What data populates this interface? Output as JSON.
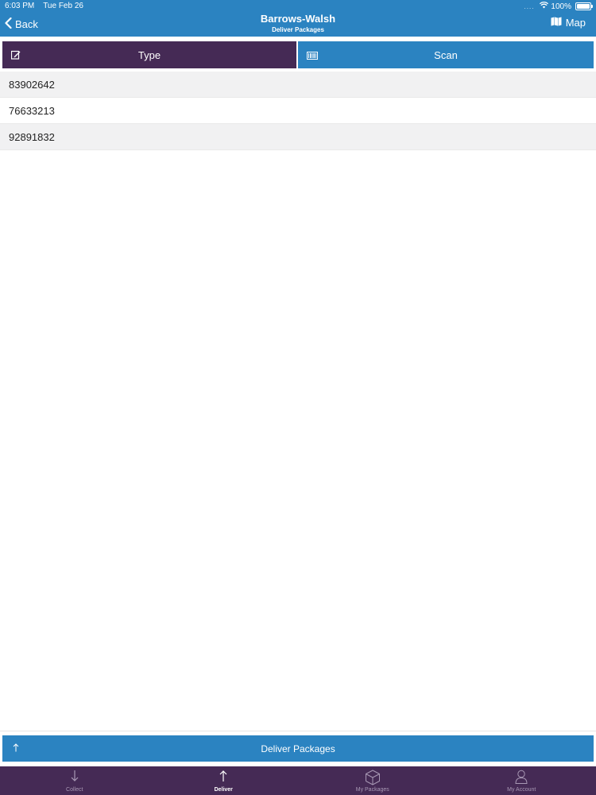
{
  "status_bar": {
    "time": "6:03 PM",
    "date": "Tue Feb 26",
    "signal": "....",
    "battery": "100%",
    "wifi_icon": "wifi-icon",
    "battery_icon": "battery-icon"
  },
  "nav": {
    "back_label": "Back",
    "title": "Barrows-Walsh",
    "subtitle": "Deliver Packages",
    "map_label": "Map"
  },
  "segments": {
    "type_label": "Type",
    "scan_label": "Scan"
  },
  "packages": [
    "83902642",
    "76633213",
    "92891832"
  ],
  "deliver_button": {
    "label": "Deliver Packages"
  },
  "tabs": [
    {
      "label": "Collect",
      "icon": "arrow-down-icon",
      "active": false
    },
    {
      "label": "Deliver",
      "icon": "arrow-up-icon",
      "active": true
    },
    {
      "label": "My Packages",
      "icon": "box-icon",
      "active": false
    },
    {
      "label": "My Account",
      "icon": "person-icon",
      "active": false
    }
  ],
  "colors": {
    "primary_blue": "#2b83c1",
    "dark_purple": "#452a55",
    "row_alt": "#f1f1f2"
  }
}
